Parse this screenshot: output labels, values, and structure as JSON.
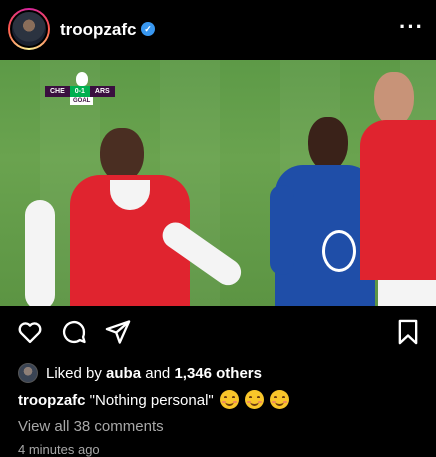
{
  "header": {
    "username": "troopzafc",
    "verified_icon": "verified-badge-icon",
    "more_icon": "more-horizontal-icon"
  },
  "scorebug": {
    "home": "CHE",
    "score": "0-1",
    "away": "ARS",
    "tag": "GOAL"
  },
  "actions": {
    "like_icon": "heart-icon",
    "comment_icon": "comment-icon",
    "share_icon": "send-icon",
    "save_icon": "bookmark-icon"
  },
  "likes": {
    "prefix": "Liked by",
    "user": "auba",
    "middle": "and",
    "count": "1,346 others"
  },
  "caption": {
    "username": "troopzafc",
    "text": "\"Nothing personal\"",
    "emoji_count": 3
  },
  "comments_link": "View all 38 comments",
  "timestamp": "4 minutes ago",
  "colors": {
    "background": "#000000",
    "arsenal_red": "#e0242f",
    "chelsea_blue": "#1f4ea8",
    "verified": "#3897f0"
  }
}
